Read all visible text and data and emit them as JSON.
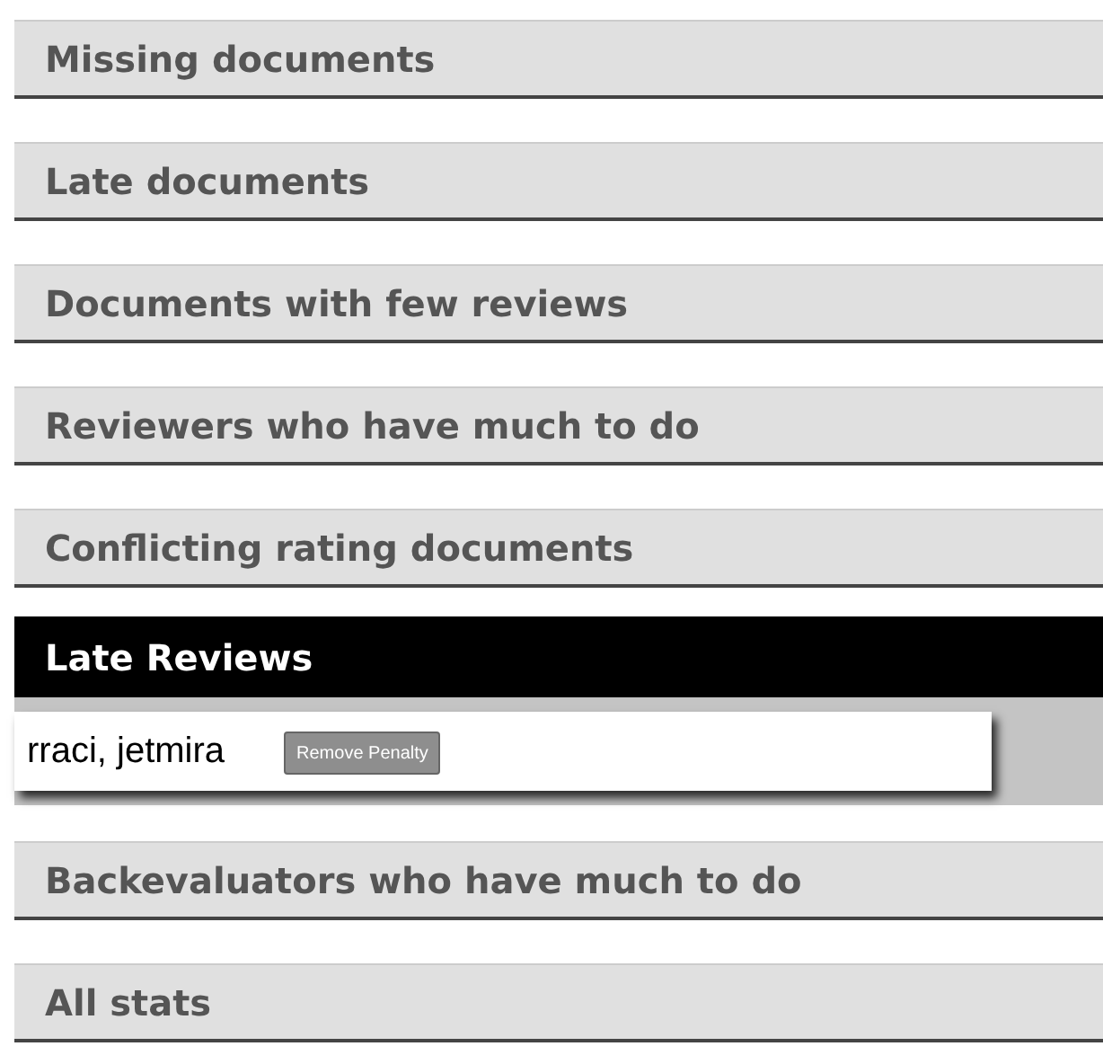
{
  "sections": [
    {
      "title": "Missing documents",
      "expanded": false
    },
    {
      "title": "Late documents",
      "expanded": false
    },
    {
      "title": "Documents with few reviews",
      "expanded": false
    },
    {
      "title": "Reviewers who have much to do",
      "expanded": false
    },
    {
      "title": "Conflicting rating documents",
      "expanded": false
    },
    {
      "title": "Late Reviews",
      "expanded": true,
      "items": [
        {
          "names": "rraci, jetmira",
          "button": "Remove Penalty"
        }
      ]
    },
    {
      "title": "Backevaluators who have much to do",
      "expanded": false
    },
    {
      "title": "All stats",
      "expanded": false
    }
  ]
}
